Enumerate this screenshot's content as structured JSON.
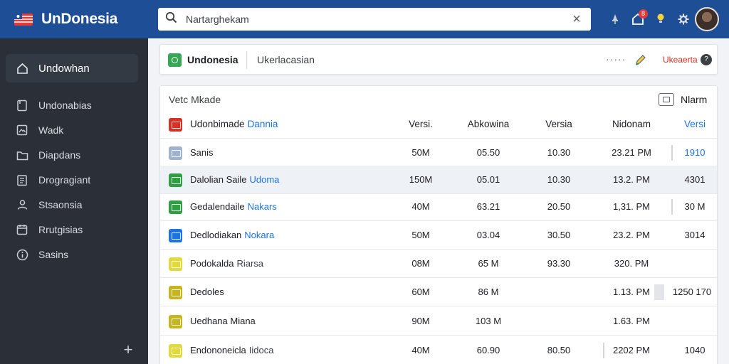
{
  "brand": {
    "name": "UnDonesia"
  },
  "sidebar": {
    "items": [
      {
        "label": "Undowhan",
        "icon": "home-icon",
        "active": true
      },
      {
        "label": "Undonabias",
        "icon": "document-icon"
      },
      {
        "label": "Wadk",
        "icon": "image-icon"
      },
      {
        "label": "Diapdans",
        "icon": "folder-icon"
      },
      {
        "label": "Drogragiant",
        "icon": "clipboard-icon"
      },
      {
        "label": "Stsaonsia",
        "icon": "users-icon"
      },
      {
        "label": "Rrutgisias",
        "icon": "calendar-icon"
      },
      {
        "label": "Sasins",
        "icon": "info-icon"
      }
    ],
    "add_label": "+"
  },
  "search": {
    "placeholder": "Nartarghekam",
    "clear_label": "×"
  },
  "topbar": {
    "notification_count": "8"
  },
  "context": {
    "title": "Undonesia",
    "subtitle": "Ukerlacasian",
    "dots": "·····",
    "link": "Ukeaerta",
    "help": "?"
  },
  "table": {
    "label": "Vetc Mkade",
    "view_label": "Nlarm",
    "header": {
      "name": "Udonbimade",
      "name_tag": "Dannia",
      "c1": "Versi.",
      "c2": "Abkowina",
      "c3": "Versia",
      "c4": "Nidonam",
      "c5": "Versi"
    },
    "rows": [
      {
        "name": "Sanis",
        "tag": "",
        "c1": "50M",
        "c2": "05.50",
        "c3": "10.30",
        "c4": "23.21 PM",
        "c5": "1910",
        "color": "#9fb3cf",
        "c5_blue": true
      },
      {
        "name": "Dalolian Saile",
        "tag": "Udoma",
        "c1": "150M",
        "c2": "05.01",
        "c3": "10.30",
        "c4": "13.2. PM",
        "c5": "4301",
        "color": "#2ea043"
      },
      {
        "name": "Gedalendaile",
        "tag": "Nakars",
        "c1": "40M",
        "c2": "63.21",
        "c3": "20.50",
        "c4": "1,31. PM",
        "c5": "30 M",
        "color": "#2ea043"
      },
      {
        "name": "Dedlodiakan",
        "tag": "Nokara",
        "c1": "50M",
        "c2": "03.04",
        "c3": "30.50",
        "c4": "23.2. PM",
        "c5": "3014",
        "color": "#1a73e8"
      },
      {
        "name": "Podokalda",
        "tag": "Riarsa",
        "c1": "08M",
        "c2": "65 M",
        "c3": "93.30",
        "c4": "320. PM",
        "c5": "",
        "color": "#e4d93b",
        "tag_dark": true
      },
      {
        "name": "Dedoles",
        "tag": "",
        "c1": "60M",
        "c2": "86 M",
        "c3": "",
        "c4": "1.13. PM",
        "c5": "1250 170",
        "color": "#c6b51f"
      },
      {
        "name": "Uedhana Miana",
        "tag": "",
        "c1": "90M",
        "c2": "103 M",
        "c3": "",
        "c4": "1.63. PM",
        "c5": "",
        "color": "#c6b51f"
      },
      {
        "name": "Endononeicla",
        "tag": "Iidoca",
        "c1": "40M",
        "c2": "60.90",
        "c3": "80.50",
        "c4": "2202 PM",
        "c5": "1040",
        "color": "#e4d93b",
        "tag_dark": true
      }
    ]
  }
}
